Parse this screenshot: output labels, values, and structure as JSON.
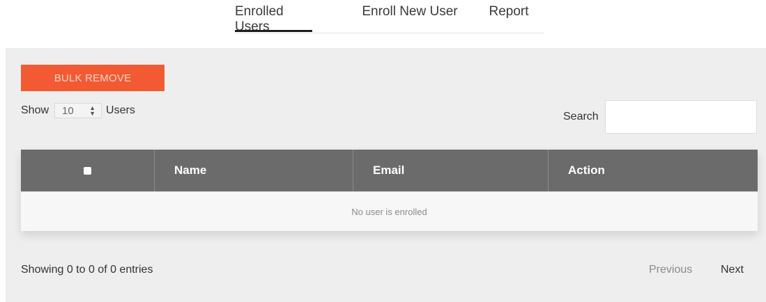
{
  "tabs": [
    {
      "label": "Enrolled Users",
      "active": true
    },
    {
      "label": "Enroll New User",
      "active": false
    },
    {
      "label": "Report",
      "active": false
    }
  ],
  "toolbar": {
    "bulk_remove_label": "BULK REMOVE",
    "show_label": "Show",
    "page_size_value": "10",
    "users_label": "Users",
    "search_label": "Search",
    "search_value": ""
  },
  "table": {
    "columns": [
      "",
      "Name",
      "Email",
      "Action"
    ],
    "empty_message": "No user is enrolled"
  },
  "footer": {
    "info": "Showing 0 to 0 of 0 entries",
    "previous_label": "Previous",
    "next_label": "Next"
  },
  "colors": {
    "accent_button": "#f25a34",
    "table_header": "#6b6b6b",
    "panel_bg": "#eeeeee"
  }
}
